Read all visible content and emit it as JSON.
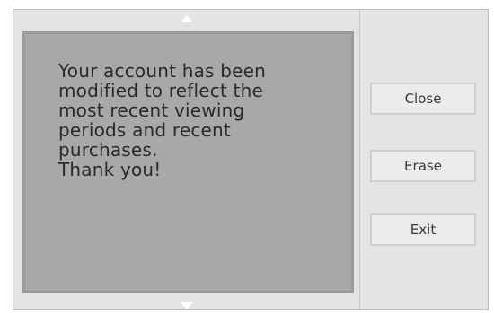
{
  "dialog": {
    "message": "Your account has been\nmodified to reflect the\nmost recent viewing\nperiods and recent\npurchases.\nThank you!"
  },
  "buttons": {
    "close_label": "Close",
    "erase_label": "Erase",
    "exit_label": "Exit"
  },
  "icons": {
    "scroll_up": "triangle-up",
    "scroll_down": "triangle-down"
  },
  "colors": {
    "message_background": "#a8a8a8",
    "window_background": "#e4e4e4",
    "button_background": "#ececec"
  }
}
